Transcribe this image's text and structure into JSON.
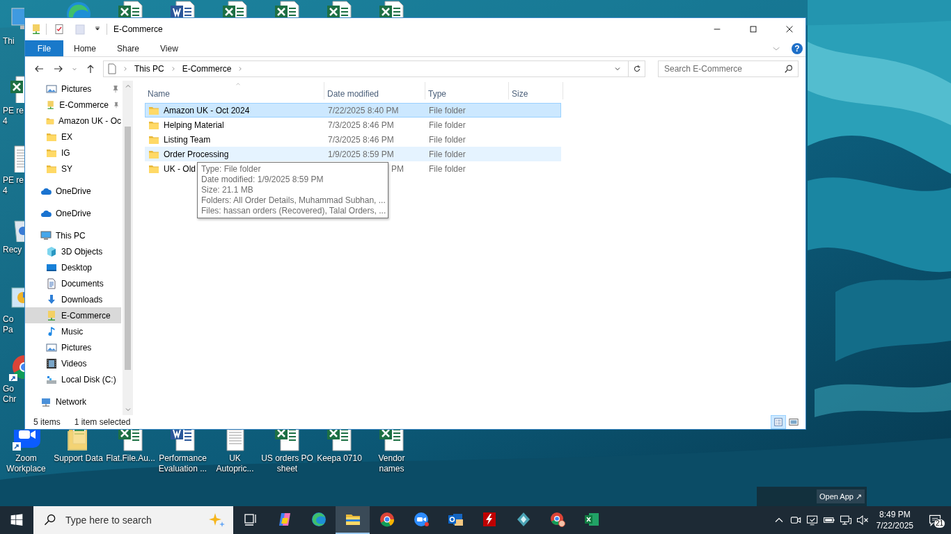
{
  "desktop": {
    "top_icons": [
      {
        "kind": "edge"
      },
      {
        "kind": "excel"
      },
      {
        "kind": "word"
      },
      {
        "kind": "excel"
      },
      {
        "kind": "excel"
      },
      {
        "kind": "excel"
      },
      {
        "kind": "excel"
      }
    ],
    "left_icons": [
      {
        "kind": "pc",
        "shortcut": false,
        "lines": [
          "Thi"
        ]
      },
      {
        "kind": "excel",
        "shortcut": false,
        "lines": [
          "PE re",
          "4"
        ]
      },
      {
        "kind": "text",
        "shortcut": false,
        "lines": [
          "PE re",
          "4"
        ]
      },
      {
        "kind": "recycle",
        "shortcut": false,
        "lines": [
          "Recy"
        ]
      },
      {
        "kind": "control",
        "shortcut": false,
        "lines": [
          "Co",
          "Pa"
        ]
      },
      {
        "kind": "chrome",
        "shortcut": true,
        "lines": [
          "Go",
          "Chr"
        ]
      }
    ],
    "bottom_icons": [
      {
        "kind": "zoom",
        "shortcut": true,
        "lines": [
          "Zoom",
          "Workplace"
        ]
      },
      {
        "kind": "supportfolder",
        "shortcut": false,
        "lines": [
          "Support Data"
        ]
      },
      {
        "kind": "excel",
        "shortcut": false,
        "lines": [
          "Flat.File.Au..."
        ]
      },
      {
        "kind": "word",
        "shortcut": false,
        "lines": [
          "Performance",
          "Evaluation ..."
        ]
      },
      {
        "kind": "text",
        "shortcut": false,
        "lines": [
          "UK",
          "Autopric..."
        ]
      },
      {
        "kind": "excel",
        "shortcut": false,
        "lines": [
          "US orders PO",
          "sheet"
        ]
      },
      {
        "kind": "excel",
        "shortcut": false,
        "lines": [
          "Keepa 0710"
        ]
      },
      {
        "kind": "excel",
        "shortcut": false,
        "lines": [
          "Vendor",
          "names"
        ]
      }
    ],
    "open_app": "Open App ↗"
  },
  "window": {
    "title": "E-Commerce",
    "ribbon_tabs": [
      {
        "label": "File",
        "kind": "file"
      },
      {
        "label": "Home",
        "kind": "tab"
      },
      {
        "label": "Share",
        "kind": "tab"
      },
      {
        "label": "View",
        "kind": "tab"
      }
    ],
    "help": "?",
    "address": [
      "This PC",
      "E-Commerce"
    ],
    "search_placeholder": "Search E-Commerce"
  },
  "sidebar": {
    "quick_access": [
      {
        "label": "Pictures",
        "kind": "pictures",
        "pinned": true,
        "selected": false
      },
      {
        "label": "E-Commerce",
        "kind": "netfolder",
        "pinned": true,
        "selected": false
      },
      {
        "label": "Amazon UK - Oc",
        "kind": "folder",
        "pinned": false,
        "selected": false
      },
      {
        "label": "EX",
        "kind": "folder",
        "pinned": false,
        "selected": false
      },
      {
        "label": "IG",
        "kind": "folder",
        "pinned": false,
        "selected": false
      },
      {
        "label": "SY",
        "kind": "folder",
        "pinned": false,
        "selected": false
      }
    ],
    "items": [
      {
        "label": "OneDrive",
        "kind": "cloud",
        "selected": false
      },
      {
        "label": "OneDrive",
        "kind": "cloud",
        "selected": false
      },
      {
        "label": "This PC",
        "kind": "pc",
        "selected": false,
        "children": [
          {
            "label": "3D Objects",
            "kind": "cube",
            "selected": false
          },
          {
            "label": "Desktop",
            "kind": "desktop",
            "selected": false
          },
          {
            "label": "Documents",
            "kind": "documents",
            "selected": false
          },
          {
            "label": "Downloads",
            "kind": "downloads",
            "selected": false
          },
          {
            "label": "E-Commerce",
            "kind": "netfolder",
            "selected": true
          },
          {
            "label": "Music",
            "kind": "music",
            "selected": false
          },
          {
            "label": "Pictures",
            "kind": "pictures",
            "selected": false
          },
          {
            "label": "Videos",
            "kind": "videos",
            "selected": false
          },
          {
            "label": "Local Disk (C:)",
            "kind": "disk",
            "selected": false
          }
        ]
      },
      {
        "label": "Network",
        "kind": "network",
        "selected": false
      }
    ]
  },
  "table": {
    "columns": [
      {
        "label": "Name",
        "sorted": true
      },
      {
        "label": "Date modified",
        "sorted": false
      },
      {
        "label": "Type",
        "sorted": false
      },
      {
        "label": "Size",
        "sorted": false
      }
    ],
    "rows": [
      {
        "name": "Amazon UK - Oct 2024",
        "date": "7/22/2025 8:40 PM",
        "type": "File folder",
        "selected": true,
        "hovered": false
      },
      {
        "name": "Helping Material",
        "date": "7/3/2025 8:46 PM",
        "type": "File folder",
        "selected": false,
        "hovered": false
      },
      {
        "name": "Listing Team",
        "date": "7/3/2025 8:46 PM",
        "type": "File folder",
        "selected": false,
        "hovered": false
      },
      {
        "name": "Order Processing",
        "date": "1/9/2025 8:59 PM",
        "type": "File folder",
        "selected": false,
        "hovered": true
      },
      {
        "name": "UK - Old",
        "date": "PM",
        "type": "File folder",
        "selected": false,
        "hovered": false
      }
    ]
  },
  "tooltip": {
    "lines": [
      "Type: File folder",
      "Date modified: 1/9/2025 8:59 PM",
      "Size: 21.1 MB",
      "Folders: All Order Details, Muhammad Subhan, ...",
      "Files: hassan orders (Recovered), Talal Orders, ..."
    ]
  },
  "status_bar": {
    "items": "5 items",
    "selection": "1 item selected",
    "views": [
      {
        "kind": "details",
        "selected": true
      },
      {
        "kind": "large",
        "selected": false
      }
    ]
  },
  "taskbar": {
    "search_placeholder": "Type here to search",
    "apps": [
      {
        "kind": "taskview",
        "active": false
      },
      {
        "kind": "copilot",
        "active": false
      },
      {
        "kind": "edge",
        "active": false
      },
      {
        "kind": "explorer",
        "active": true
      },
      {
        "kind": "chrome",
        "active": false
      },
      {
        "kind": "zoom",
        "active": false
      },
      {
        "kind": "outlook",
        "active": false
      },
      {
        "kind": "filezilla",
        "active": false
      },
      {
        "kind": "diamond",
        "active": false
      },
      {
        "kind": "chromeprofile",
        "active": false
      },
      {
        "kind": "excel",
        "active": false
      }
    ],
    "tray": [
      {
        "kind": "chevron"
      },
      {
        "kind": "camera"
      },
      {
        "kind": "display"
      },
      {
        "kind": "battery"
      },
      {
        "kind": "network"
      },
      {
        "kind": "muted"
      }
    ],
    "time": "8:49 PM",
    "date": "7/22/2025",
    "notifications": "21"
  }
}
